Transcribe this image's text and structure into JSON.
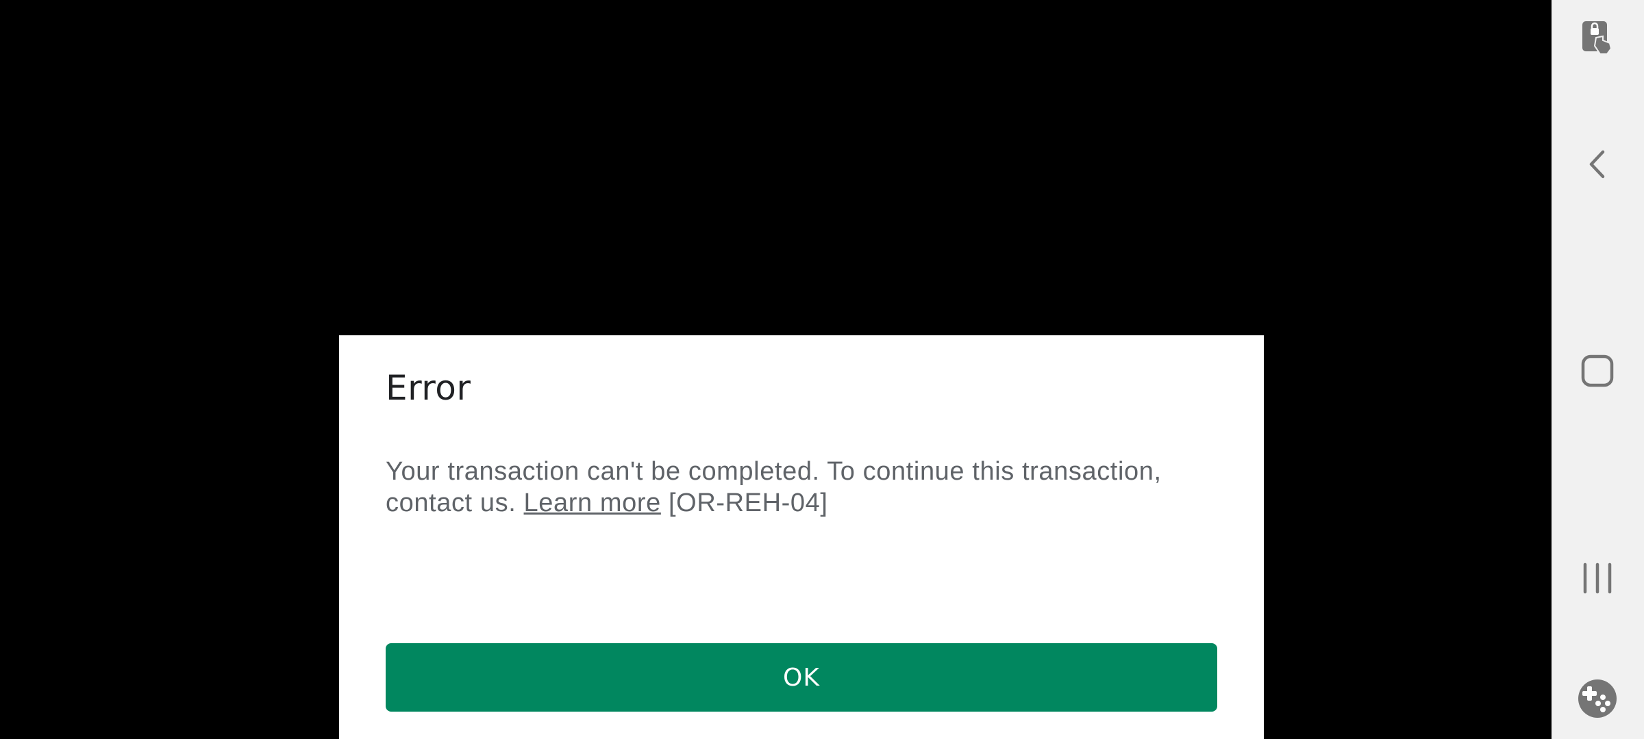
{
  "dialog": {
    "title": "Error",
    "message_before_link": "Your transaction can't be completed. To continue this transaction, contact us. ",
    "link_label": "Learn more",
    "message_after_link": " [OR-REH-04]",
    "ok_label": "OK"
  },
  "colors": {
    "primary_button": "#01875f",
    "dialog_background": "#ffffff",
    "title_text": "#202124",
    "body_text": "#5f6368",
    "nav_background": "#f1f1f1",
    "nav_icon": "#757575"
  },
  "nav_bar": {
    "icons": [
      "screen-pin-icon",
      "back-icon",
      "home-icon",
      "recents-icon",
      "game-tools-icon"
    ]
  }
}
